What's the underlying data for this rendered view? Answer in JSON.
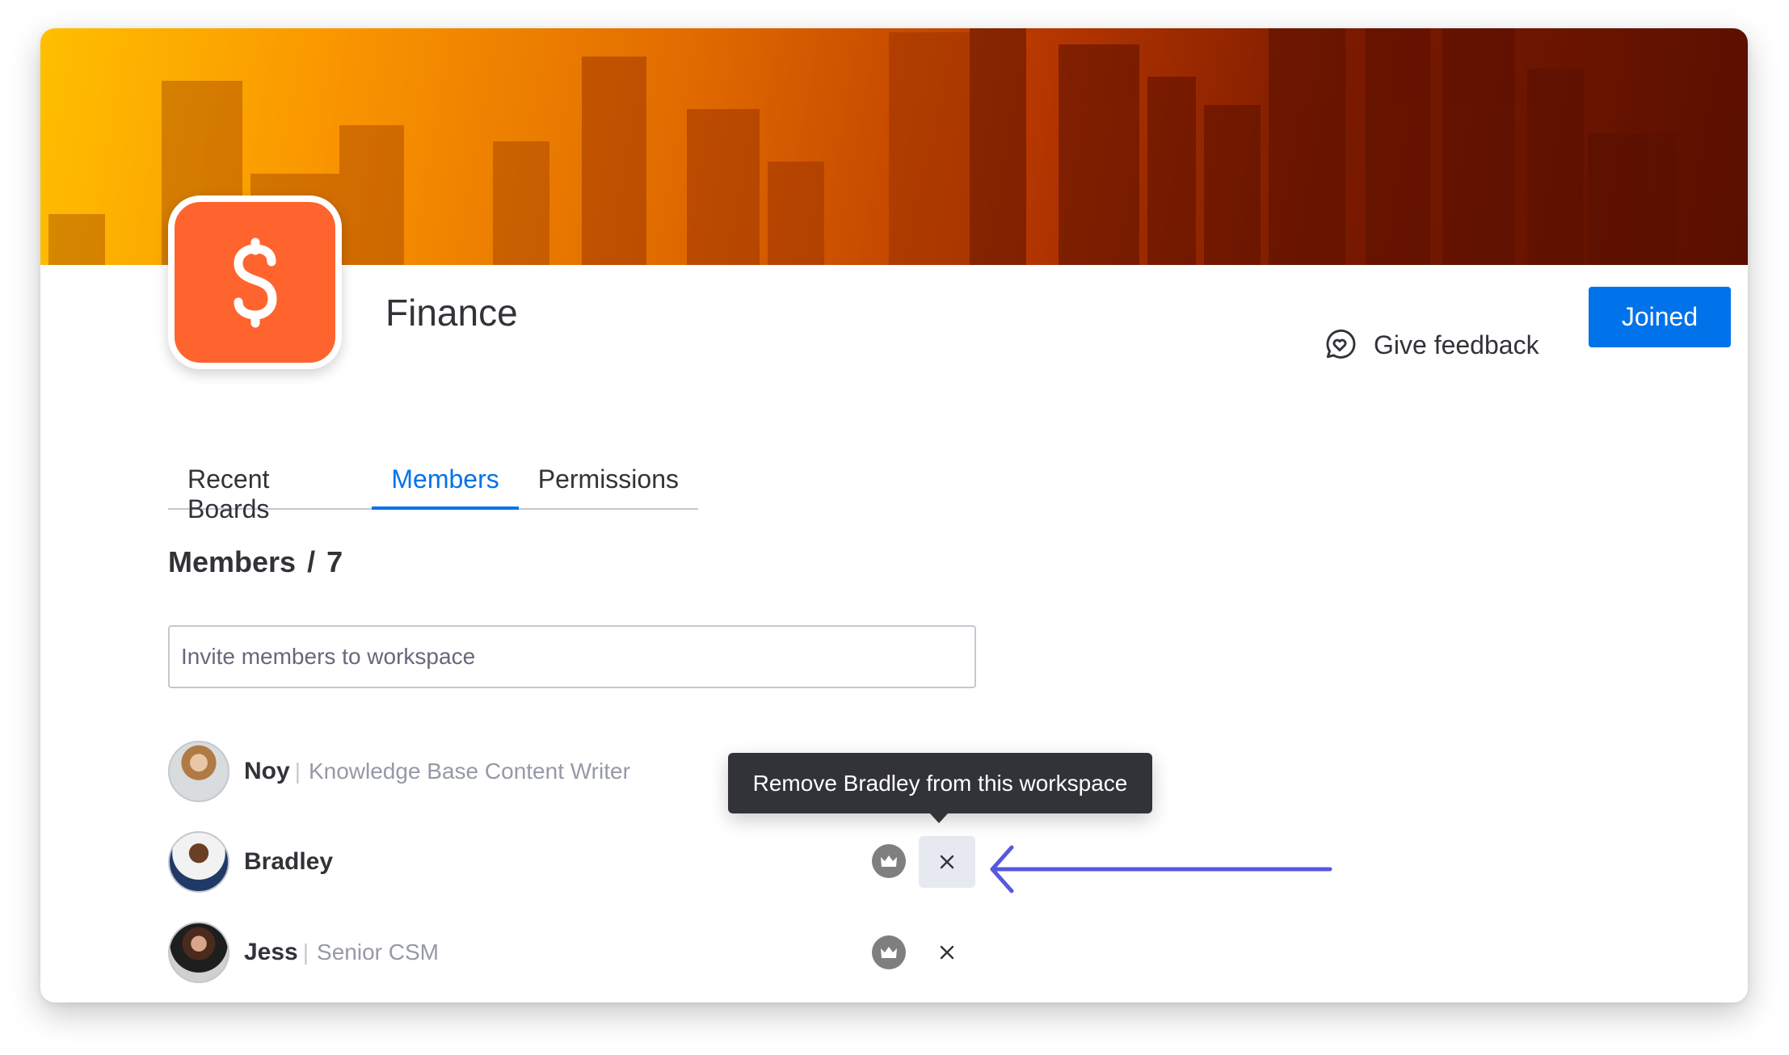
{
  "workspace": {
    "name": "Finance",
    "icon": "dollar-sign-icon",
    "icon_color": "#ff642e"
  },
  "header": {
    "feedback_label": "Give feedback",
    "feedback_icon": "chat-heart-icon",
    "joined_label": "Joined",
    "joined_color": "#0073ea"
  },
  "tabs": [
    {
      "label": "Recent Boards",
      "active": false
    },
    {
      "label": "Members",
      "active": true
    },
    {
      "label": "Permissions",
      "active": false
    }
  ],
  "members_section": {
    "heading": "Members",
    "separator": "/",
    "count": "7",
    "invite_placeholder": "Invite members to workspace"
  },
  "members": [
    {
      "name": "Noy",
      "title": "Knowledge Base Content Writer",
      "show_actions": false
    },
    {
      "name": "Bradley",
      "title": "",
      "show_actions": true,
      "hovered_remove": true
    },
    {
      "name": "Jess",
      "title": "Senior CSM",
      "show_actions": true
    }
  ],
  "tooltip": {
    "text": "Remove Bradley from this workspace"
  },
  "annotation": {
    "type": "arrow",
    "color": "#5559df"
  }
}
